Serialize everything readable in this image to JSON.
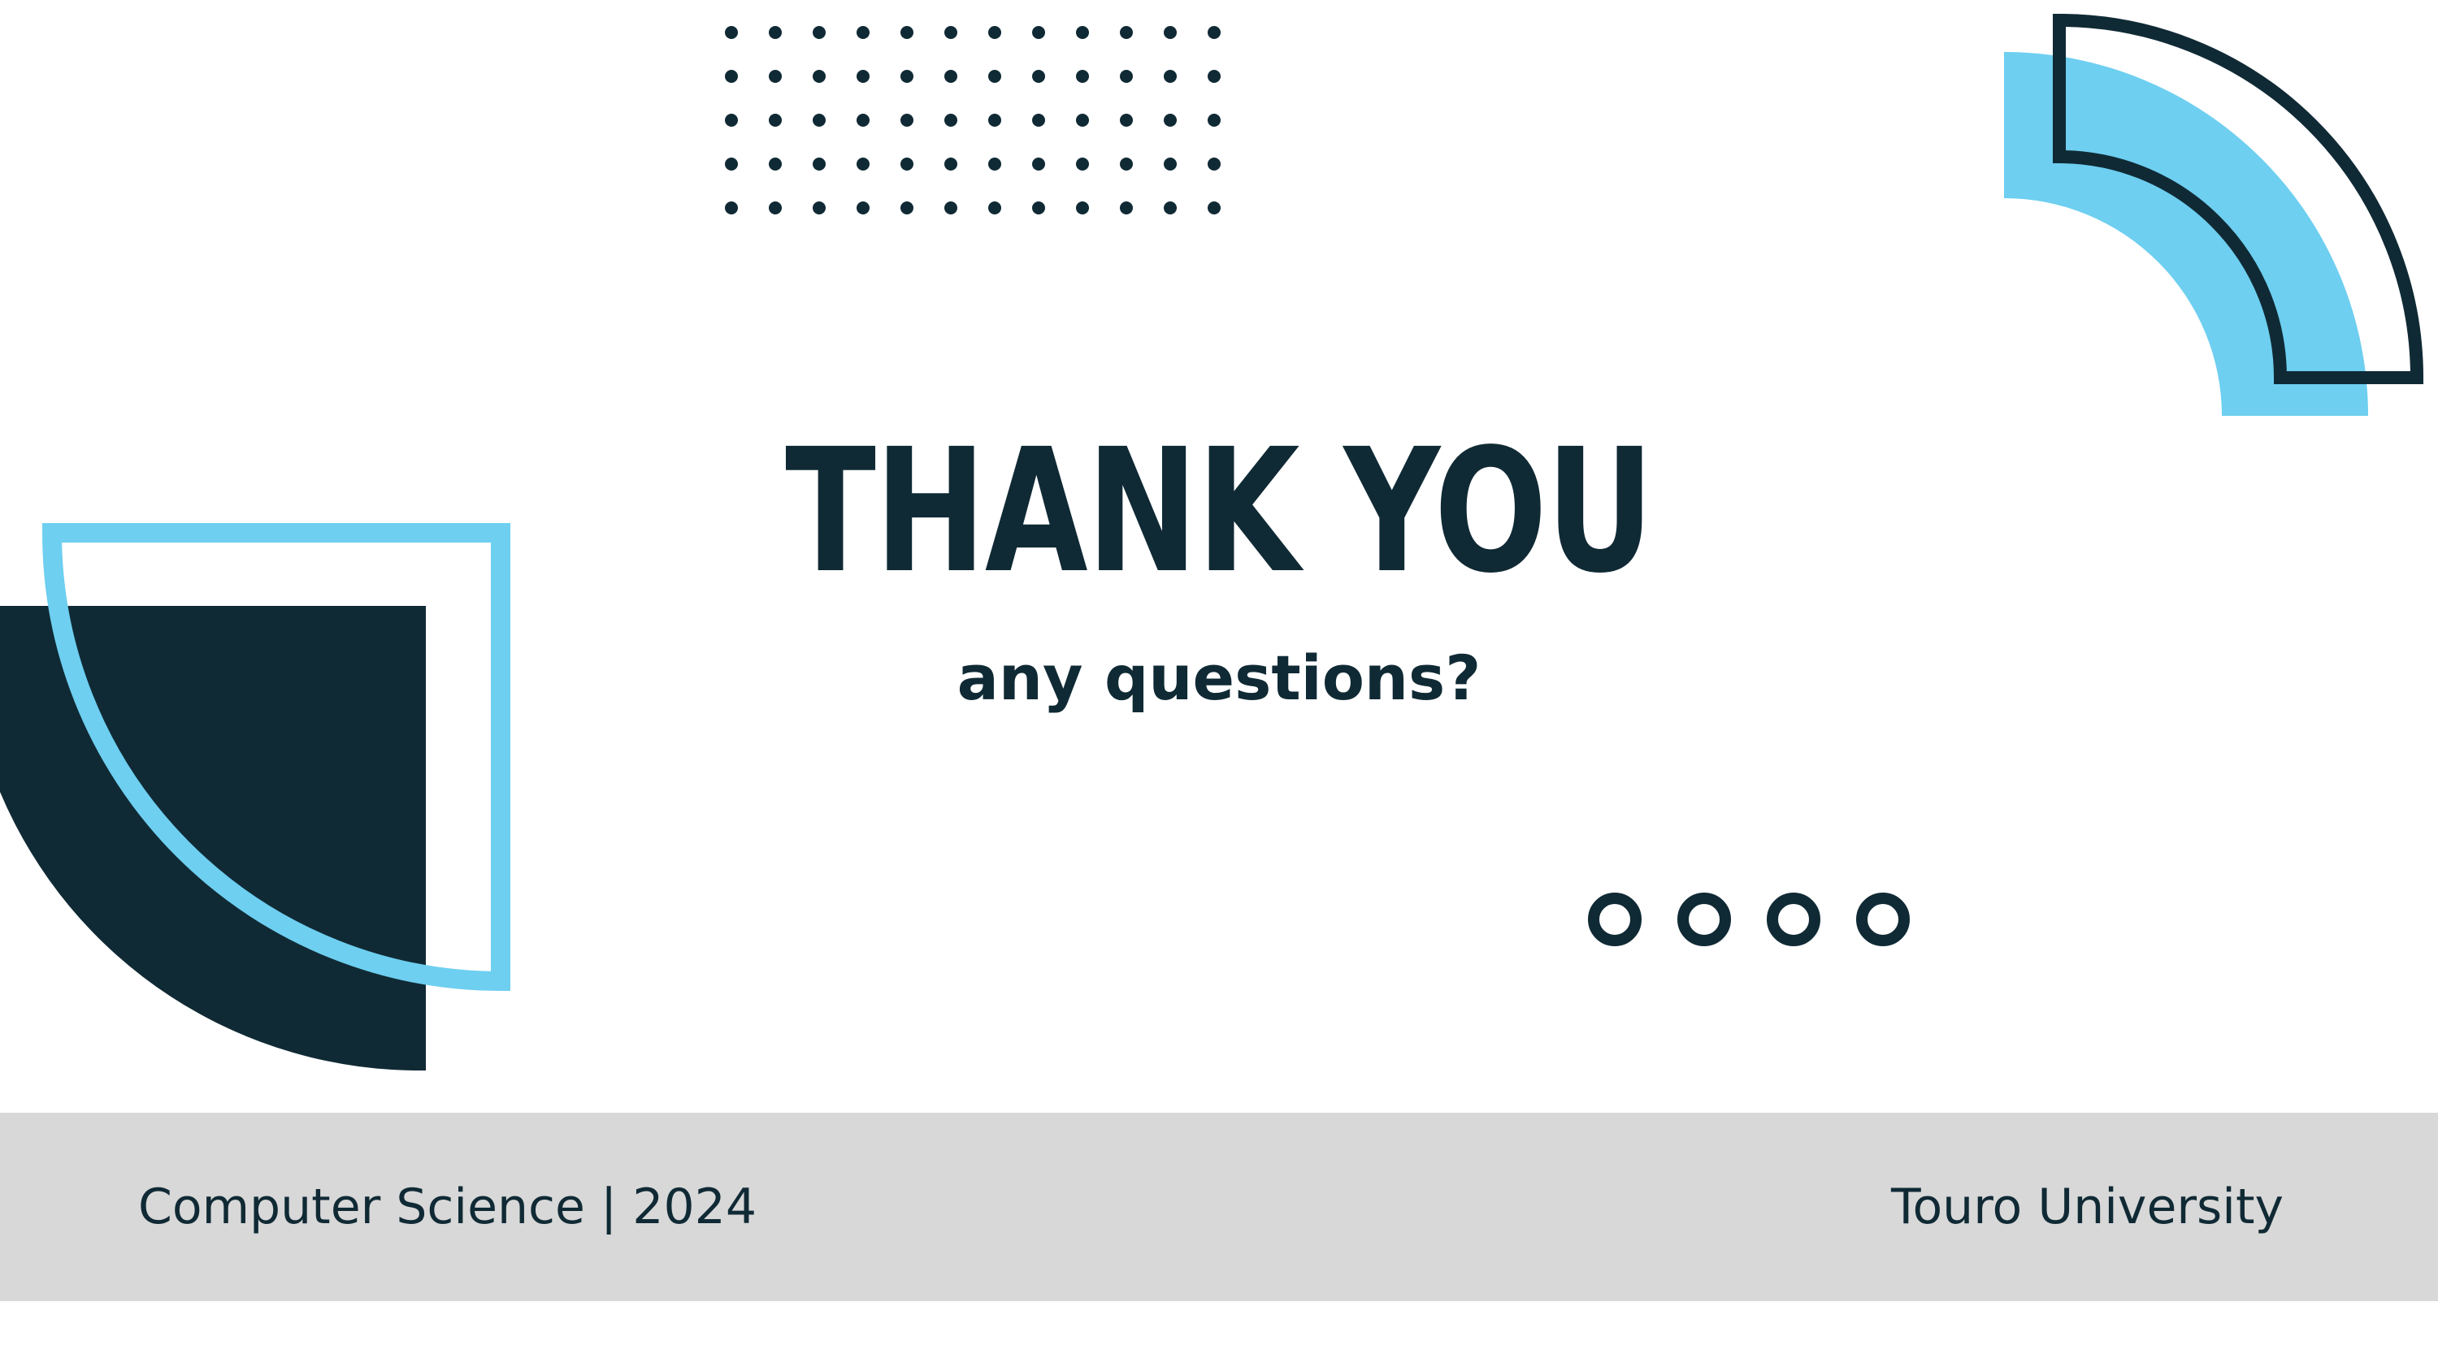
{
  "slide": {
    "title": "THANK YOU",
    "subtitle": "any questions?"
  },
  "footer": {
    "left_text": "Computer Science | 2024",
    "right_text": "Touro University"
  },
  "colors": {
    "navy": "#102a35",
    "light_blue": "#6ecff0",
    "footer_bg": "#d8d8d8",
    "background": "#ffffff"
  },
  "decorations": {
    "dot_grid": {
      "rows": 5,
      "columns": 12
    },
    "ring_count": 4
  }
}
